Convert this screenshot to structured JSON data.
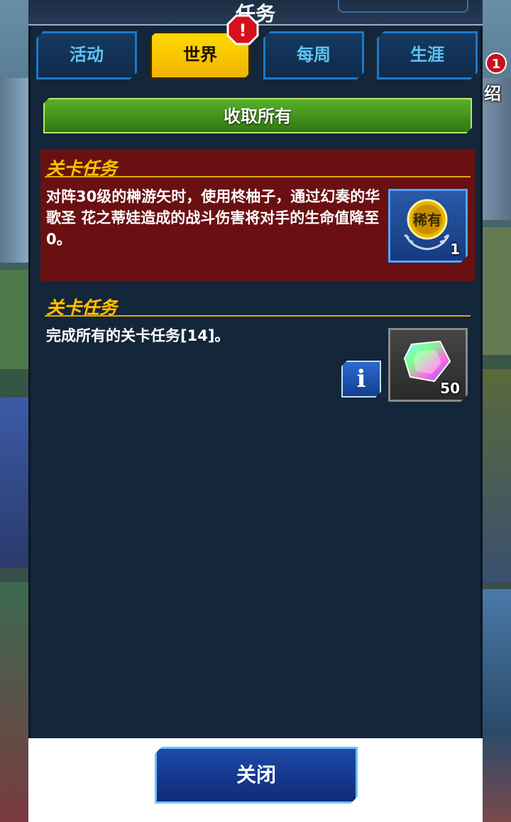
{
  "header": {
    "title": "任务"
  },
  "tabs": [
    {
      "label": "活动",
      "active": false
    },
    {
      "label": "世界",
      "active": true,
      "alert": "!"
    },
    {
      "label": "每周",
      "active": false
    },
    {
      "label": "生涯",
      "active": false
    }
  ],
  "collect_all_label": "收取所有",
  "missions": [
    {
      "title": "关卡任务",
      "description": "对阵30级的榊游矢时，使用柊柚子，通过幻奏的华歌圣 花之蒂娃造成的战斗伤害将对手的生命值降至0。",
      "reward": {
        "icon": "rare-medal-icon",
        "icon_text": "稀有",
        "quantity": "1"
      }
    },
    {
      "title": "关卡任务",
      "description": "完成所有的关卡任务[14]。",
      "reward": {
        "icon": "crystal-gem-icon",
        "quantity": "50"
      },
      "info_label": "i"
    }
  ],
  "side": {
    "badge": "1",
    "label": "绍"
  },
  "close_label": "关闭",
  "colors": {
    "accent_yellow": "#ffd800",
    "mission_red": "#6a1012",
    "panel_bg": "#13263a",
    "button_green": "#3f9420"
  }
}
